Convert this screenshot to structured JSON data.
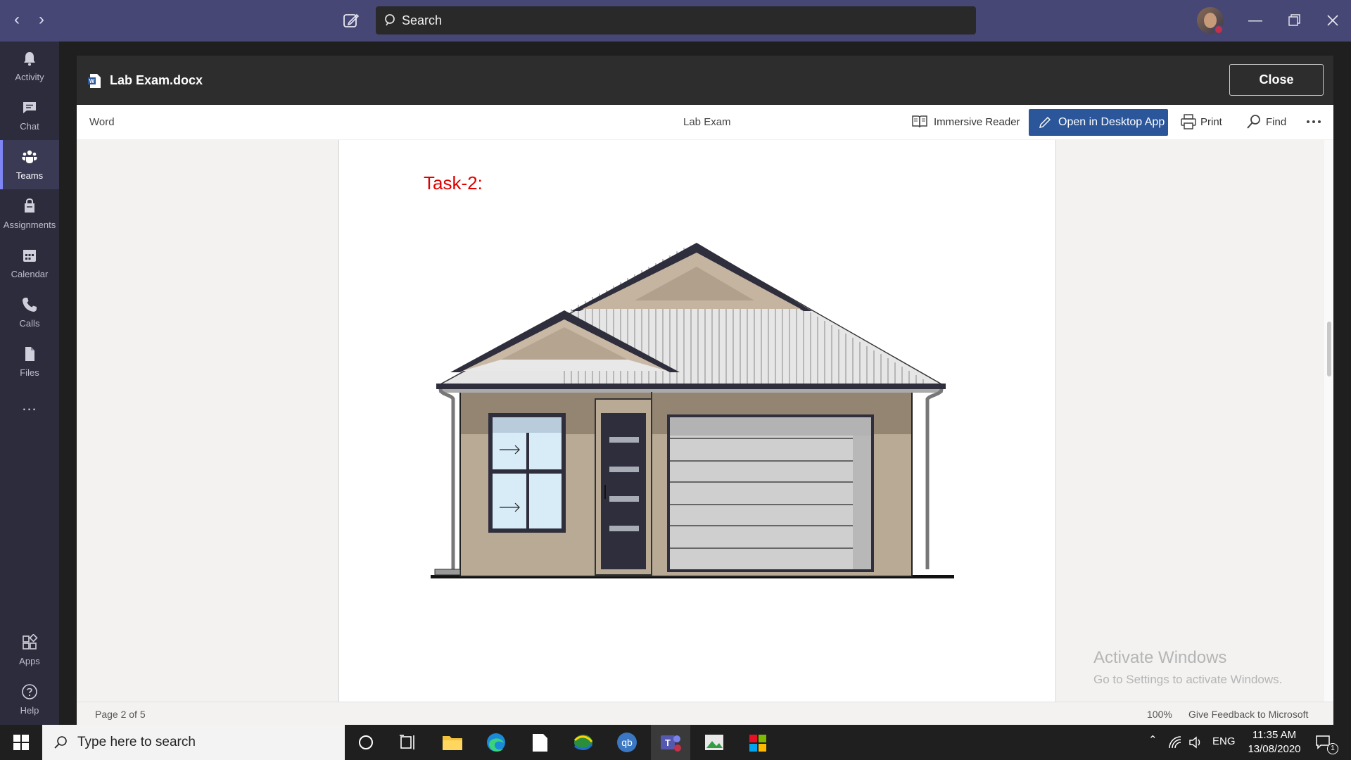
{
  "titlebar": {
    "search_placeholder": "Search",
    "window_controls": [
      "minimize",
      "restore",
      "close"
    ]
  },
  "rail": {
    "items": [
      {
        "label": "Activity",
        "icon": "bell-icon"
      },
      {
        "label": "Chat",
        "icon": "chat-icon"
      },
      {
        "label": "Teams",
        "icon": "teams-icon",
        "active": true
      },
      {
        "label": "Assignments",
        "icon": "assignments-icon"
      },
      {
        "label": "Calendar",
        "icon": "calendar-icon"
      },
      {
        "label": "Calls",
        "icon": "phone-icon"
      },
      {
        "label": "Files",
        "icon": "files-icon"
      }
    ],
    "more_label": "...",
    "bottom": [
      {
        "label": "Apps",
        "icon": "apps-icon"
      },
      {
        "label": "Help",
        "icon": "help-icon"
      }
    ]
  },
  "doc": {
    "filename": "Lab Exam.docx",
    "close_label": "Close"
  },
  "toolbar": {
    "app_name": "Word",
    "doc_title": "Lab Exam",
    "immersive_reader": "Immersive Reader",
    "open_desktop": "Open in Desktop App",
    "print": "Print",
    "find": "Find"
  },
  "page": {
    "heading": "Task-2:"
  },
  "watermark": {
    "line1": "Activate Windows",
    "line2": "Go to Settings to activate Windows."
  },
  "statusbar": {
    "page": "Page 2 of 5",
    "zoom": "100%",
    "feedback": "Give Feedback to Microsoft"
  },
  "taskbar": {
    "search_placeholder": "Type here to search",
    "language": "ENG",
    "time": "11:35 AM",
    "date": "13/08/2020",
    "notification_count": "1"
  },
  "colors": {
    "titlebar": "#464775",
    "rail": "#2d2c3c",
    "accent": "#2b579a",
    "task_heading": "#e00000"
  }
}
